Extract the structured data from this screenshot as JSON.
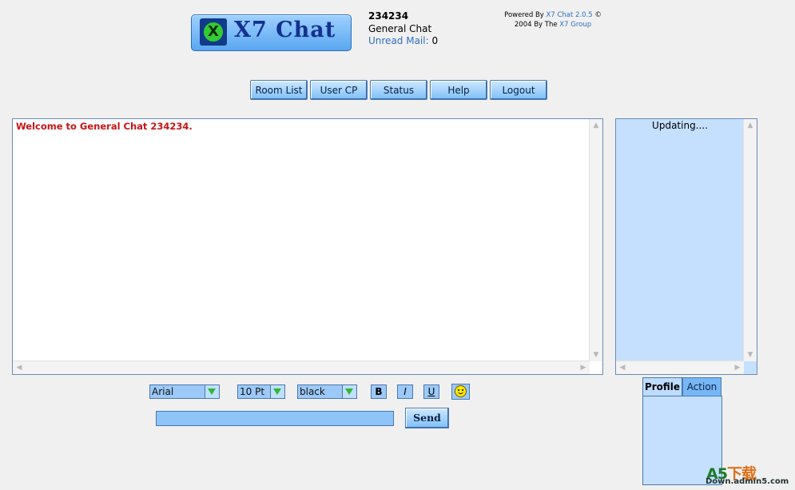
{
  "app": {
    "logo_text": "X7 Chat",
    "logo_mark": "X"
  },
  "user": {
    "username": "234234",
    "room": "General Chat",
    "unread_label": "Unread Mail:",
    "unread_count": "0"
  },
  "powered": {
    "line1_prefix": "Powered By",
    "line1_link": "X7 Chat 2.0.5",
    "line1_suffix": "©",
    "line2_prefix": "2004 By The",
    "line2_link": "X7 Group"
  },
  "nav": {
    "room_list": "Room List",
    "user_cp": "User CP",
    "status": "Status",
    "help": "Help",
    "logout": "Logout"
  },
  "chat": {
    "welcome": "Welcome to General Chat 234234."
  },
  "userlist": {
    "status": "Updating...."
  },
  "toolbar": {
    "font": "Arial",
    "size": "10 Pt",
    "color": "black",
    "bold": "B",
    "italic": "I",
    "underline": "U",
    "smiley_icon": "smiley-face-icon"
  },
  "compose": {
    "message_value": "",
    "send": "Send"
  },
  "tabs": {
    "profile": "Profile",
    "action": "Action"
  },
  "watermark": {
    "brand_a5": "A5",
    "brand_cn": "下载",
    "domain": "Down.admin5.com"
  },
  "colors": {
    "accent_blue": "#7ec0f8",
    "panel_blue": "#c5e0ff",
    "welcome_red": "#c81414",
    "link_blue": "#2f6fbf"
  }
}
